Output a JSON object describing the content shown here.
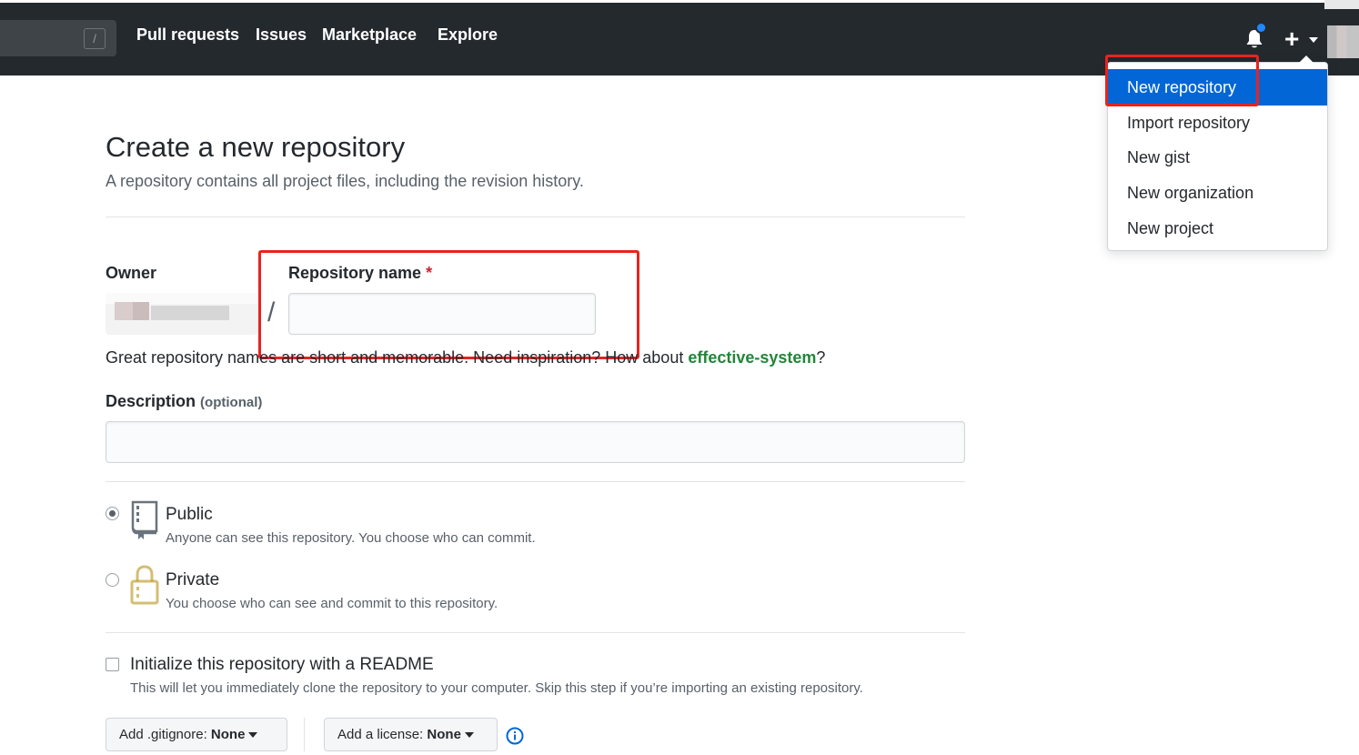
{
  "header": {
    "search_hint": "/",
    "nav": [
      "Pull requests",
      "Issues",
      "Marketplace",
      "Explore"
    ],
    "plus": "+"
  },
  "create_menu": {
    "items": [
      "New repository",
      "Import repository",
      "New gist",
      "New organization",
      "New project"
    ],
    "active_index": 0
  },
  "page": {
    "title": "Create a new repository",
    "subtitle": "A repository contains all project files, including the revision history."
  },
  "form": {
    "owner_label": "Owner",
    "separator": "/",
    "repo_name_label": "Repository name",
    "required_mark": "*",
    "repo_name_value": "",
    "help_prefix": "Great repository names are short and memorable. Need inspiration? How about ",
    "suggestion": "effective-system",
    "help_suffix": "?",
    "description_label": "Description",
    "description_optional": "(optional)",
    "description_value": "",
    "visibility": {
      "selected": "Public",
      "public_title": "Public",
      "public_desc": "Anyone can see this repository. You choose who can commit.",
      "private_title": "Private",
      "private_desc": "You choose who can see and commit to this repository."
    },
    "init_readme": {
      "checked": false,
      "title": "Initialize this repository with a README",
      "desc": "This will let you immediately clone the repository to your computer. Skip this step if you’re importing an existing repository."
    },
    "gitignore": {
      "prefix": "Add .gitignore:",
      "value": "None"
    },
    "license": {
      "prefix": "Add a license:",
      "value": "None"
    }
  },
  "colors": {
    "header_bg": "#24292e",
    "active_menu_bg": "#0366d6",
    "highlight_red": "#e8231f",
    "suggestion_green": "#22863a",
    "notification_blue": "#2188ff"
  },
  "icons": [
    "search-slash-icon",
    "bell-icon",
    "plus-icon",
    "repo-book-icon",
    "lock-icon",
    "info-icon"
  ]
}
